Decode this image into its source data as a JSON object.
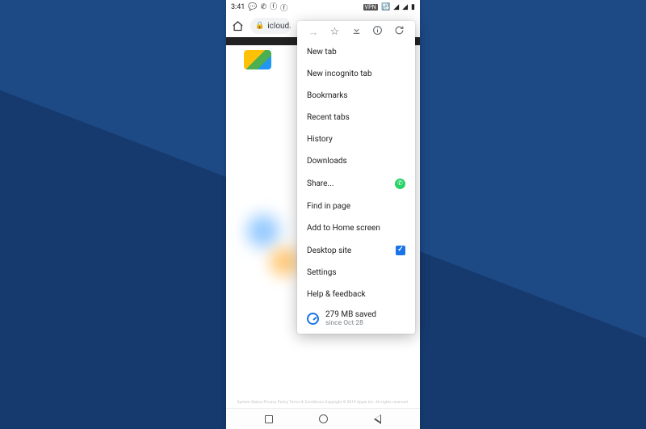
{
  "statusbar": {
    "time": "3:41",
    "vpn_label": "VPN"
  },
  "addrbar": {
    "url": "icloud.c"
  },
  "menu": {
    "items": [
      {
        "label": "New tab"
      },
      {
        "label": "New incognito tab"
      },
      {
        "label": "Bookmarks"
      },
      {
        "label": "Recent tabs"
      },
      {
        "label": "History"
      },
      {
        "label": "Downloads"
      },
      {
        "label": "Share...",
        "right": "whatsapp"
      },
      {
        "label": "Find in page"
      },
      {
        "label": "Add to Home screen"
      },
      {
        "label": "Desktop site",
        "right": "checked"
      },
      {
        "label": "Settings"
      },
      {
        "label": "Help & feedback"
      }
    ],
    "data_saved_line1": "279 MB saved",
    "data_saved_line2": "since Oct 28"
  },
  "page": {
    "footer": "System Status   Privacy Policy   Terms & Conditions   Copyright © 2019 Apple Inc. All rights reserved."
  }
}
